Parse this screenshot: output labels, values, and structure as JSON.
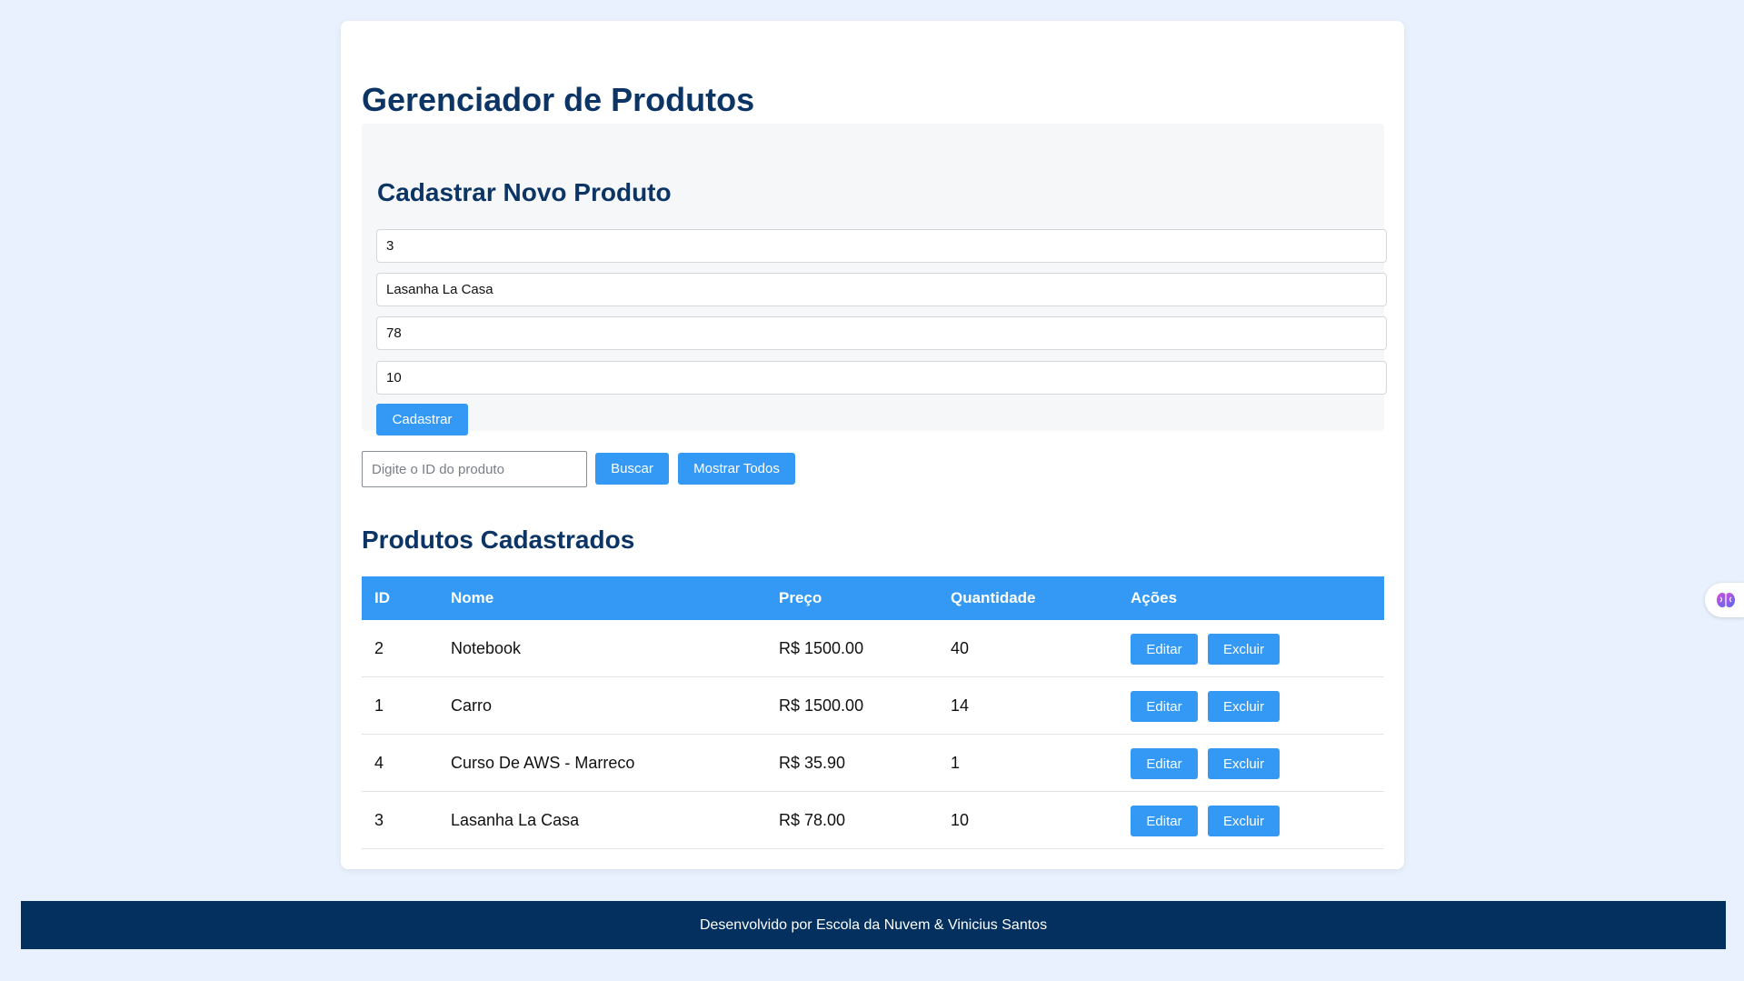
{
  "header": {
    "title": "Gerenciador de Produtos"
  },
  "form": {
    "title": "Cadastrar Novo Produto",
    "fields": [
      {
        "name": "id",
        "value": "3"
      },
      {
        "name": "nome",
        "value": "Lasanha La Casa"
      },
      {
        "name": "preco",
        "value": "78"
      },
      {
        "name": "quantidade",
        "value": "10"
      }
    ],
    "submit_label": "Cadastrar"
  },
  "search": {
    "placeholder": "Digite o ID do produto",
    "value": "",
    "search_label": "Buscar",
    "show_all_label": "Mostrar Todos"
  },
  "products": {
    "title": "Produtos Cadastrados",
    "columns": [
      "ID",
      "Nome",
      "Preço",
      "Quantidade",
      "Ações"
    ],
    "rows": [
      {
        "id": "2",
        "nome": "Notebook",
        "preco": "R$ 1500.00",
        "quantidade": "40"
      },
      {
        "id": "1",
        "nome": "Carro",
        "preco": "R$ 1500.00",
        "quantidade": "14"
      },
      {
        "id": "4",
        "nome": "Curso De AWS - Marreco",
        "preco": "R$ 35.90",
        "quantidade": "1"
      },
      {
        "id": "3",
        "nome": "Lasanha La Casa",
        "preco": "R$ 78.00",
        "quantidade": "10"
      }
    ],
    "edit_label": "Editar",
    "delete_label": "Excluir"
  },
  "footer": {
    "text": "Desenvolvido por Escola da Nuvem & Vinicius Santos"
  },
  "extension": {
    "icon": "brain-icon"
  },
  "colors": {
    "background": "#e8f1fd",
    "title": "#0c3566",
    "accent": "#3399f5",
    "footer": "#03305f"
  }
}
